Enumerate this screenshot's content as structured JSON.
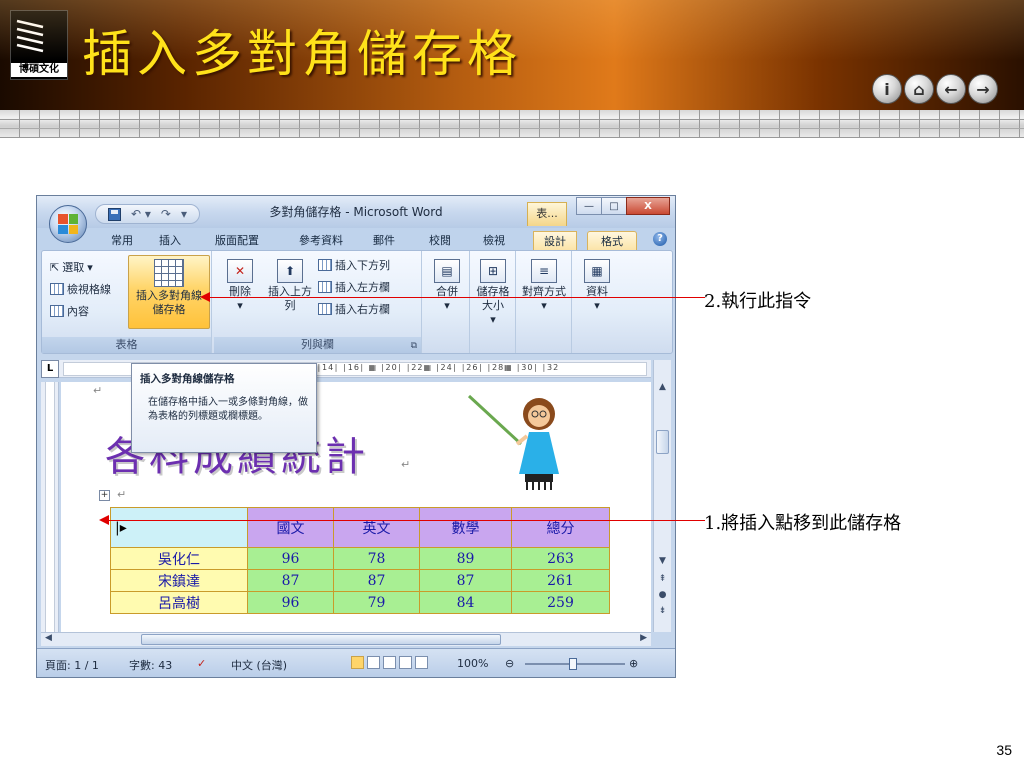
{
  "slide": {
    "title": "插入多對角儲存格",
    "logo_text": "博碩文化",
    "page_number": "35",
    "nav_buttons": [
      {
        "icon": "info-icon",
        "glyph": "i"
      },
      {
        "icon": "home-icon",
        "glyph": "⌂"
      },
      {
        "icon": "back-icon",
        "glyph": "←"
      },
      {
        "icon": "forward-icon",
        "glyph": "→"
      }
    ]
  },
  "callouts": {
    "step2": "2.執行此指令",
    "step1": "1.將插入點移到此儲存格"
  },
  "window": {
    "title": "多對角儲存格 - Microsoft Word",
    "context_tab": "表...",
    "controls": {
      "minimize": "—",
      "maximize": "□",
      "close": "X"
    }
  },
  "ribbon": {
    "tabs": [
      "常用",
      "插入",
      "版面配置",
      "參考資料",
      "郵件",
      "校閱",
      "檢視",
      "設計",
      "格式"
    ],
    "active_tab": "格式",
    "groups": {
      "table": {
        "label": "表格",
        "select": "選取",
        "gridlines": "檢視格線",
        "properties": "內容",
        "insert_diag": "插入多對角線儲存格"
      },
      "rows_cols": {
        "label": "列與欄",
        "delete": "刪除",
        "insert_above": "插入上方列",
        "insert_below": "插入下方列",
        "insert_left": "插入左方欄",
        "insert_right": "插入右方欄"
      },
      "merge": "合併",
      "cell_size": "儲存格大小",
      "alignment": "對齊方式",
      "data": "資料"
    }
  },
  "tooltip": {
    "title": "插入多對角線儲存格",
    "body": "在儲存格中插入一或多條對角線，做為表格的列標題或欄標題。"
  },
  "document": {
    "heading": "各科成績統計",
    "table": {
      "headers": [
        "",
        "國文",
        "英文",
        "數學",
        "總分"
      ],
      "rows": [
        [
          "吳化仁",
          "96",
          "78",
          "89",
          "263"
        ],
        [
          "宋鎮達",
          "87",
          "87",
          "87",
          "261"
        ],
        [
          "呂高樹",
          "96",
          "79",
          "84",
          "259"
        ]
      ]
    },
    "ruler_text": "∣14∣ ∣16∣ ▦ ∣20∣ ∣22▦ ∣24∣ ∣26∣ ∣28▦ ∣30∣ ∣32"
  },
  "statusbar": {
    "page": "頁面: 1 / 1",
    "words": "字數: 43",
    "language": "中文 (台灣)",
    "zoom": "100%"
  }
}
